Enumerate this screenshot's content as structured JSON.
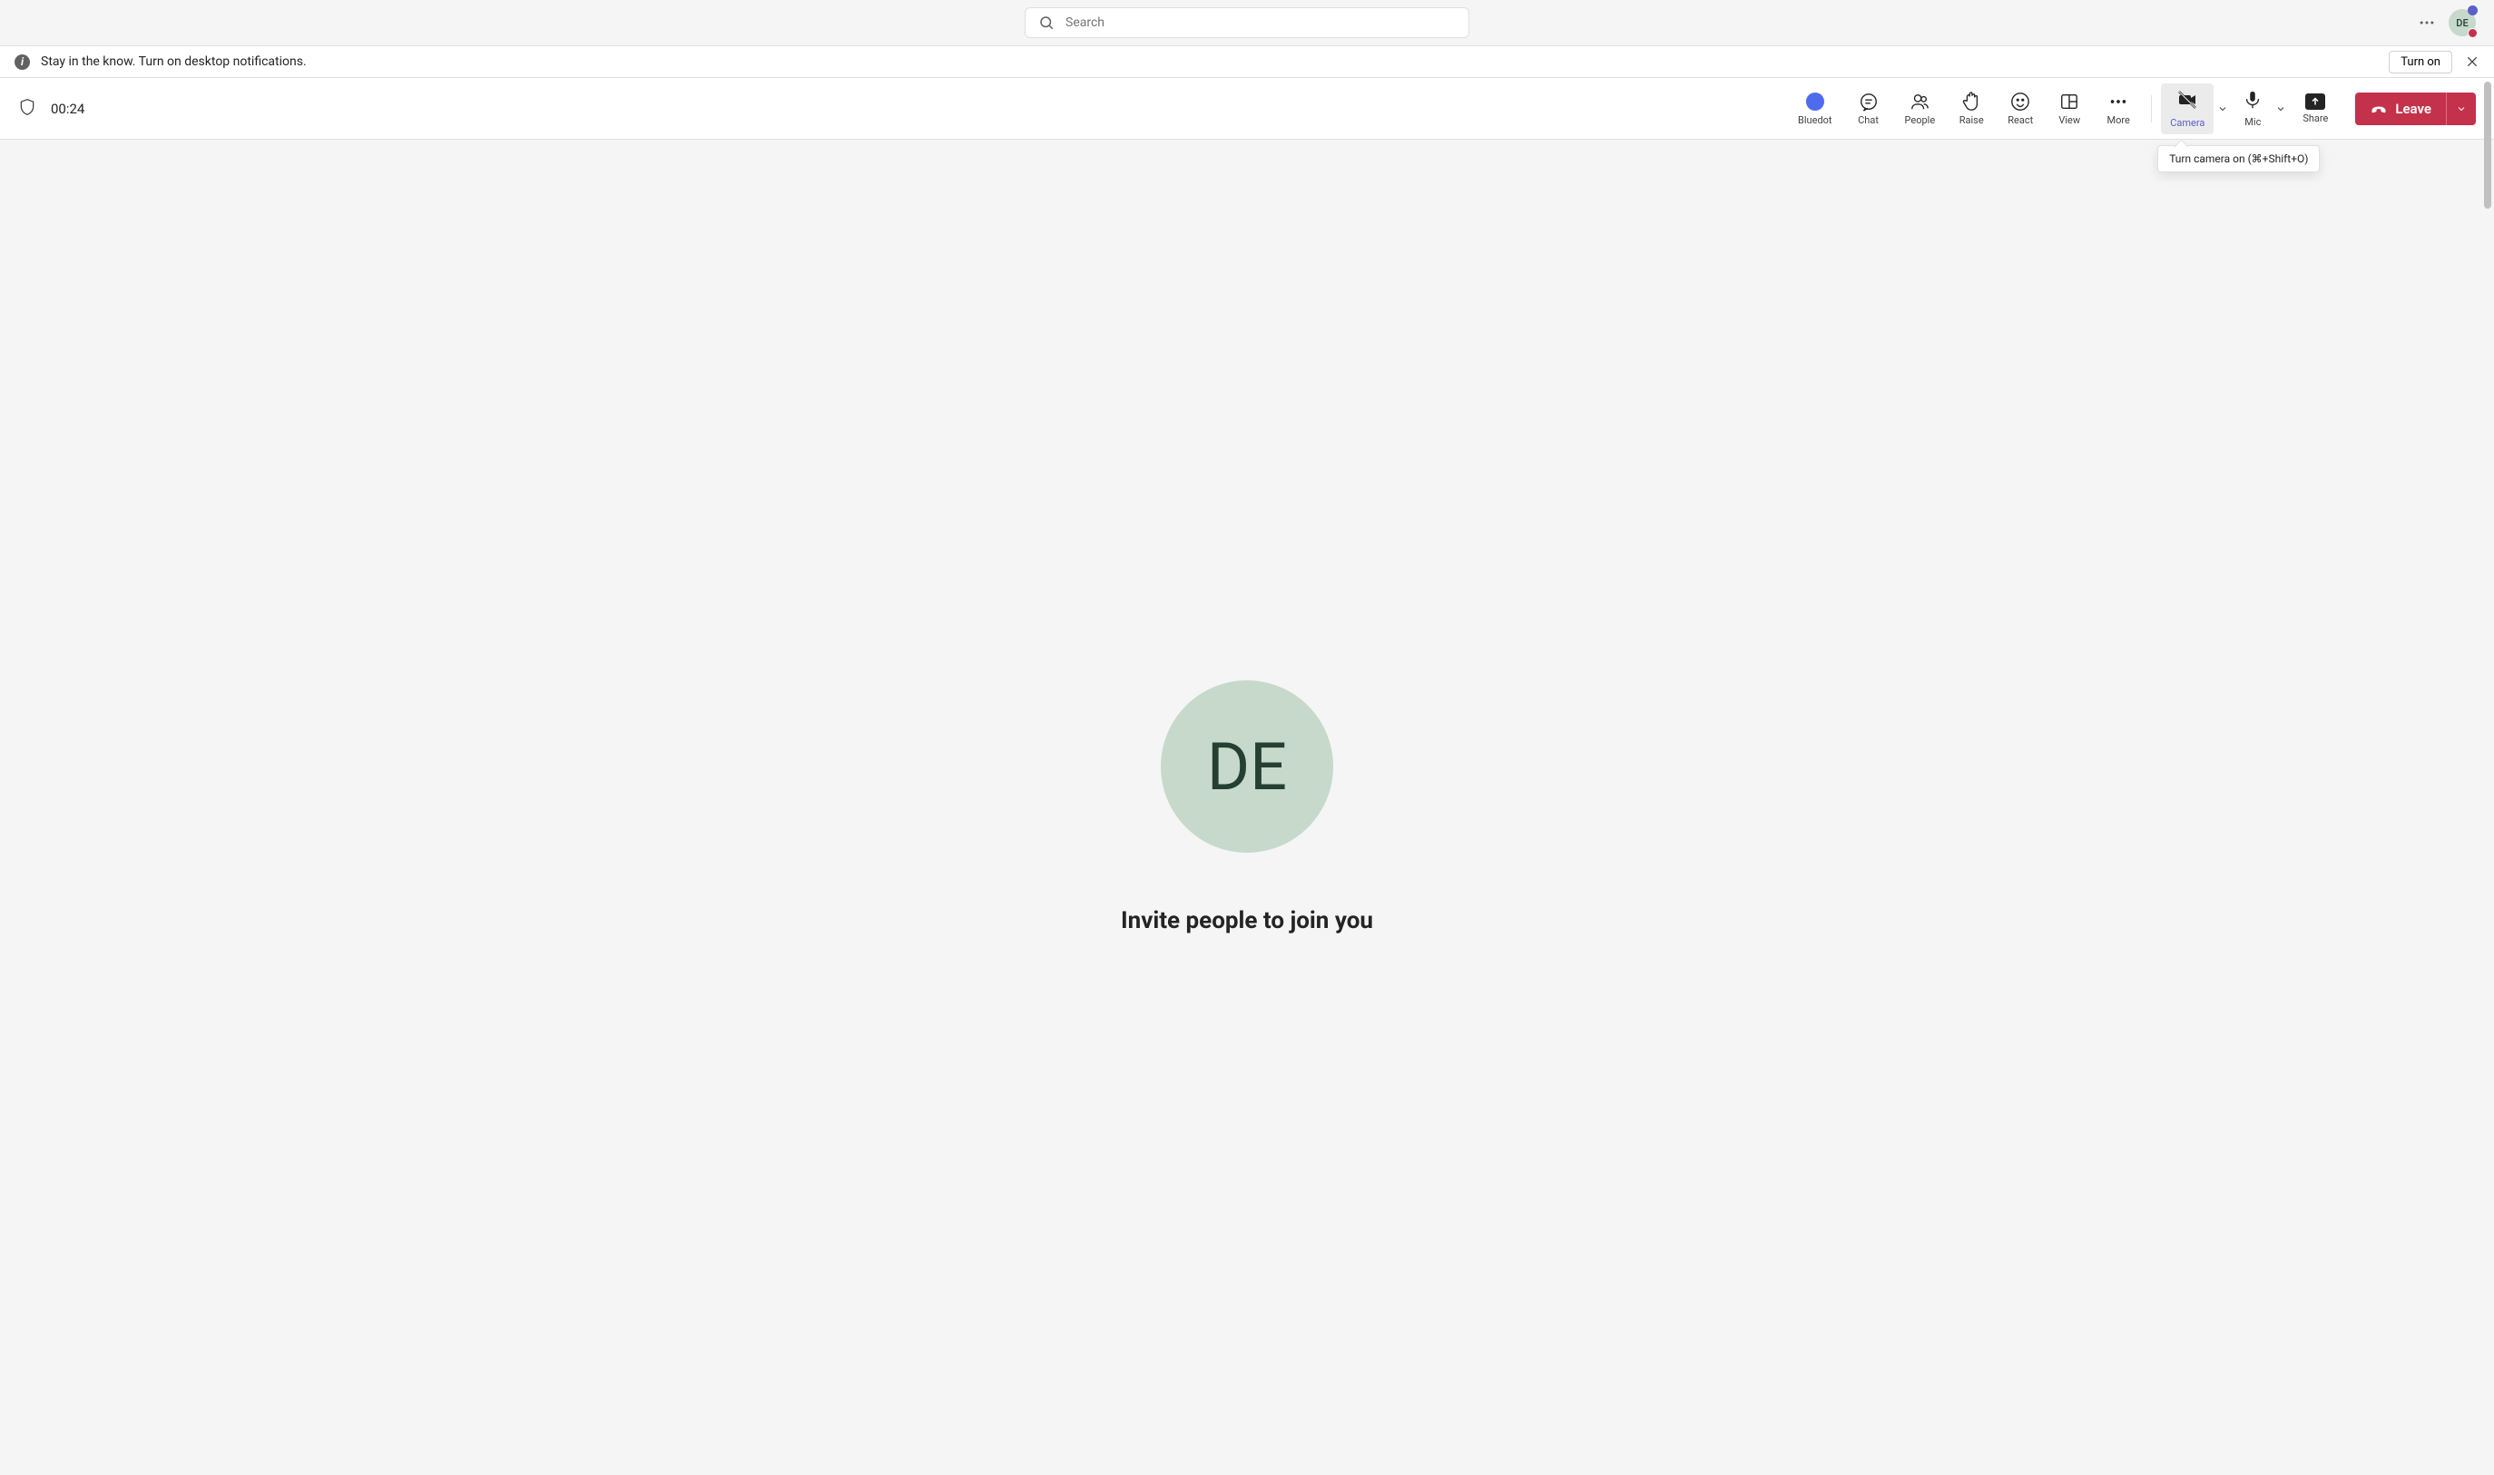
{
  "topBar": {
    "searchPlaceholder": "Search",
    "avatarInitials": "DE"
  },
  "notificationBar": {
    "message": "Stay in the know. Turn on desktop notifications.",
    "turnOnLabel": "Turn on"
  },
  "meetingToolbar": {
    "timer": "00:24",
    "bluedot": "Bluedot",
    "chat": "Chat",
    "people": "People",
    "raise": "Raise",
    "react": "React",
    "view": "View",
    "more": "More",
    "camera": "Camera",
    "mic": "Mic",
    "share": "Share",
    "leave": "Leave",
    "tooltip": "Turn camera on (⌘+Shift+O)"
  },
  "mainArea": {
    "avatarInitials": "DE",
    "inviteText": "Invite people to join you"
  }
}
